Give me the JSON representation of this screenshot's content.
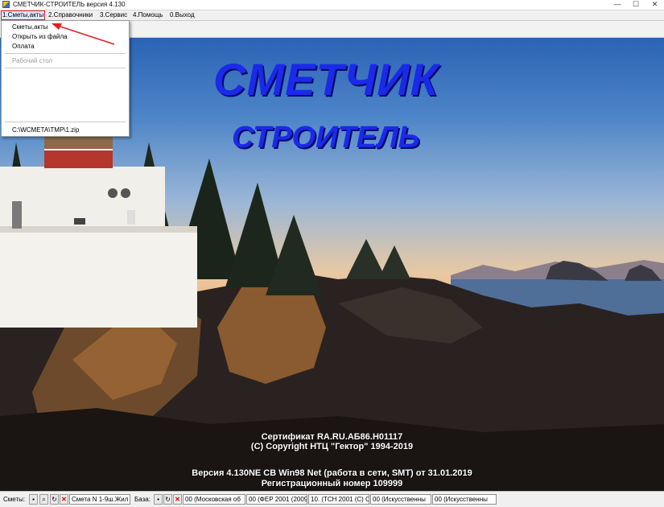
{
  "window": {
    "title": "СМЕТЧИК-СТРОИТЕЛЬ версия 4.130",
    "controls": {
      "minimize": "—",
      "maximize": "☐",
      "close": "✕"
    }
  },
  "menu": {
    "items": [
      "1.Сметы,акты",
      "2.Справочники",
      "3.Сервис",
      "4.Помощь",
      "0.Выход"
    ]
  },
  "dropdown": {
    "items": [
      "Сметы,акты",
      "Открыть из файла",
      "Оплата"
    ],
    "disabled_item": "Рабочий стол",
    "recent_file": "C:\\WCMETA\\TMP\\1.zip"
  },
  "splash": {
    "logo_line1": "СМЕТЧИК",
    "logo_line2": "СТРОИТЕЛЬ",
    "certificate": "Сертификат RA.RU.АБ86.Н01117",
    "copyright": "(С) Copyright НТЦ \"Гектор\" 1994-2019",
    "version": "Версия  4.130NE СВ Win98 Net (работа в сети, SMT) от 31.01.2019",
    "reg_number": "Регистрационный номер 109999"
  },
  "statusbar": {
    "smety_label": "Сметы:",
    "baza_label": "База:",
    "smeta_field": "Смета N 1-9ш.Жил",
    "base_fields": [
      "00 (Московская об",
      "00 (ФЕР 2001 (2009",
      "10. (ТСН 2001 (С) С",
      "00 (Искусственны",
      "00 (Искусственны"
    ]
  },
  "colors": {
    "logo": "#1a2ae8",
    "highlight_outline": "#e02020",
    "annotation_arrow": "#e02020"
  }
}
